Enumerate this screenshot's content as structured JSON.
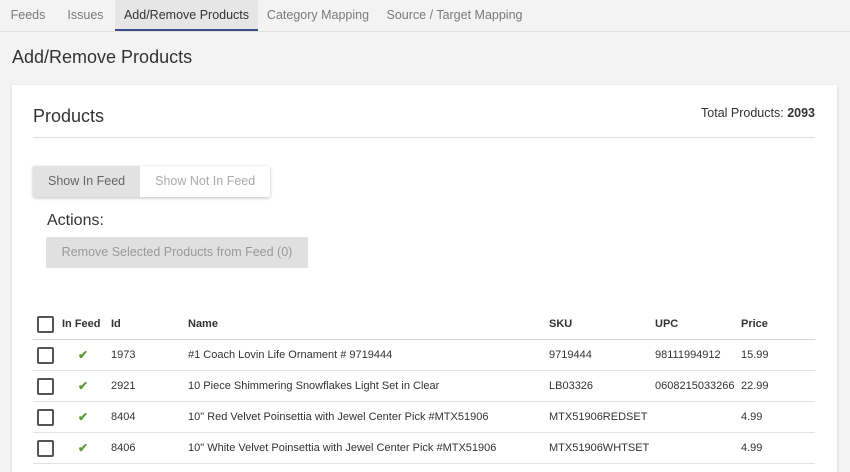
{
  "tabs": [
    {
      "label": "Feeds"
    },
    {
      "label": "Issues"
    },
    {
      "label": "Add/Remove Products"
    },
    {
      "label": "Category Mapping"
    },
    {
      "label": "Source / Target Mapping"
    }
  ],
  "active_tab": "Add/Remove Products",
  "page_title": "Add/Remove Products",
  "card": {
    "title": "Products",
    "total_label": "Total Products:",
    "total_value": "2093",
    "toggle": {
      "show_in_feed": "Show In Feed",
      "show_not_in_feed": "Show Not In Feed",
      "selected": "Show In Feed"
    },
    "actions_label": "Actions:",
    "remove_button": "Remove Selected Products from Feed (0)"
  },
  "table": {
    "columns": {
      "in_feed": "In Feed",
      "id": "Id",
      "name": "Name",
      "sku": "SKU",
      "upc": "UPC",
      "price": "Price"
    },
    "rows": [
      {
        "in_feed": "✔",
        "id": "1973",
        "name": "#1 Coach Lovin Life Ornament # 9719444",
        "sku": "9719444",
        "upc": "98111994912",
        "price": "15.99"
      },
      {
        "in_feed": "✔",
        "id": "2921",
        "name": "10 Piece Shimmering Snowflakes Light Set in Clear",
        "sku": "LB03326",
        "upc": "0608215033266",
        "price": "22.99"
      },
      {
        "in_feed": "✔",
        "id": "8404",
        "name": "10\" Red Velvet Poinsettia with Jewel Center Pick #MTX51906",
        "sku": "MTX51906REDSET",
        "upc": "",
        "price": "4.99"
      },
      {
        "in_feed": "✔",
        "id": "8406",
        "name": "10\" White Velvet Poinsettia with Jewel Center Pick #MTX51906",
        "sku": "MTX51906WHTSET",
        "upc": "",
        "price": "4.99"
      }
    ]
  },
  "colors": {
    "active_tab_underline": "#3b4e8c",
    "check": "#5b9b3a"
  }
}
